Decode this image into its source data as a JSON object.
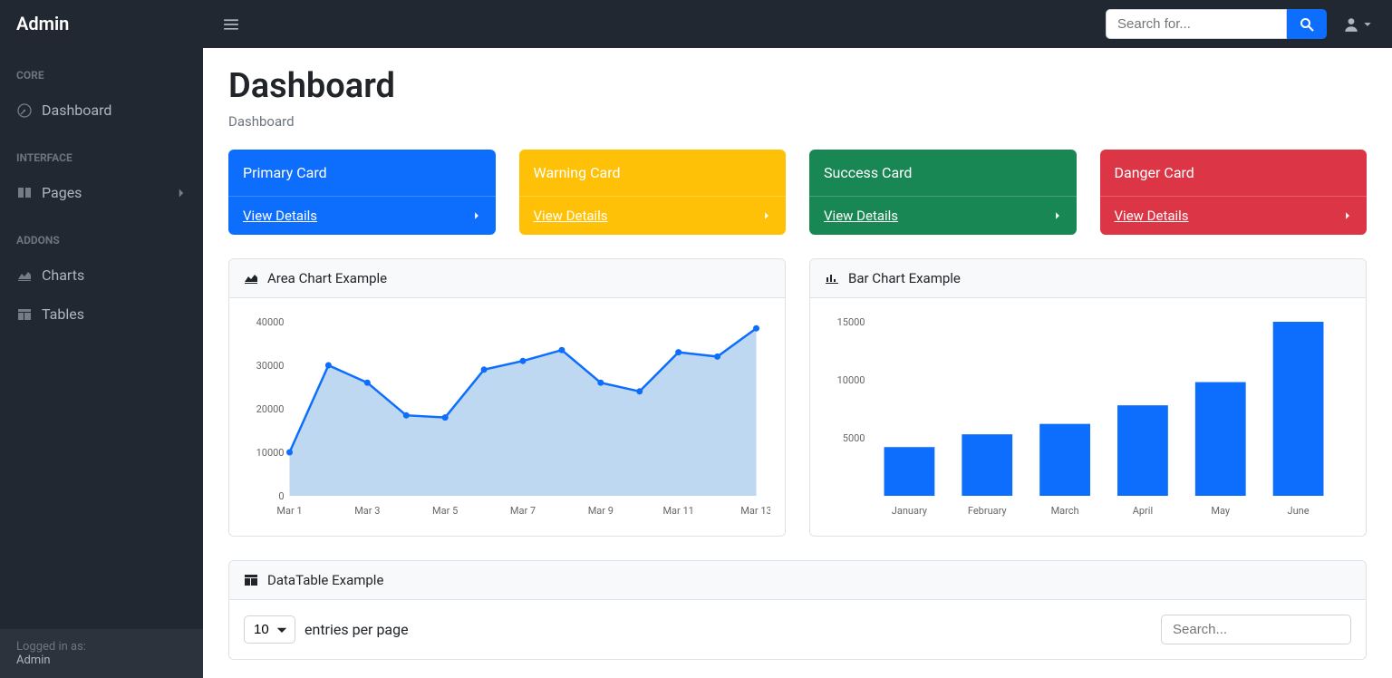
{
  "brand": "Admin",
  "topbar": {
    "search_placeholder": "Search for..."
  },
  "sidebar": {
    "heading_core": "CORE",
    "heading_interface": "INTERFACE",
    "heading_addons": "ADDONS",
    "dashboard": "Dashboard",
    "pages": "Pages",
    "charts": "Charts",
    "tables": "Tables",
    "footer_label": "Logged in as:",
    "footer_user": "Admin"
  },
  "page": {
    "title": "Dashboard",
    "breadcrumb": "Dashboard"
  },
  "cards": {
    "primary": {
      "title": "Primary Card",
      "link": "View Details"
    },
    "warning": {
      "title": "Warning Card",
      "link": "View Details"
    },
    "success": {
      "title": "Success Card",
      "link": "View Details"
    },
    "danger": {
      "title": "Danger Card",
      "link": "View Details"
    }
  },
  "area_chart_title": "Area Chart Example",
  "bar_chart_title": "Bar Chart Example",
  "datatable": {
    "title": "DataTable Example",
    "entries_value": "10",
    "entries_label": "entries per page",
    "search_placeholder": "Search..."
  },
  "chart_data": [
    {
      "type": "area",
      "title": "Area Chart Example",
      "x_labels": [
        "Mar 1",
        "Mar 3",
        "Mar 5",
        "Mar 7",
        "Mar 9",
        "Mar 11",
        "Mar 13"
      ],
      "x": [
        "Mar 1",
        "Mar 2",
        "Mar 3",
        "Mar 4",
        "Mar 5",
        "Mar 6",
        "Mar 7",
        "Mar 8",
        "Mar 9",
        "Mar 10",
        "Mar 11",
        "Mar 12",
        "Mar 13"
      ],
      "values": [
        10000,
        30000,
        26000,
        18500,
        18000,
        29000,
        31000,
        33500,
        26000,
        24000,
        33000,
        32000,
        38500
      ],
      "ylim": [
        0,
        40000
      ],
      "y_ticks": [
        0,
        10000,
        20000,
        30000,
        40000
      ]
    },
    {
      "type": "bar",
      "title": "Bar Chart Example",
      "categories": [
        "January",
        "February",
        "March",
        "April",
        "May",
        "June"
      ],
      "values": [
        4200,
        5300,
        6200,
        7800,
        9800,
        15000
      ],
      "ylim": [
        0,
        15000
      ],
      "y_ticks": [
        5000,
        10000,
        15000
      ]
    }
  ]
}
